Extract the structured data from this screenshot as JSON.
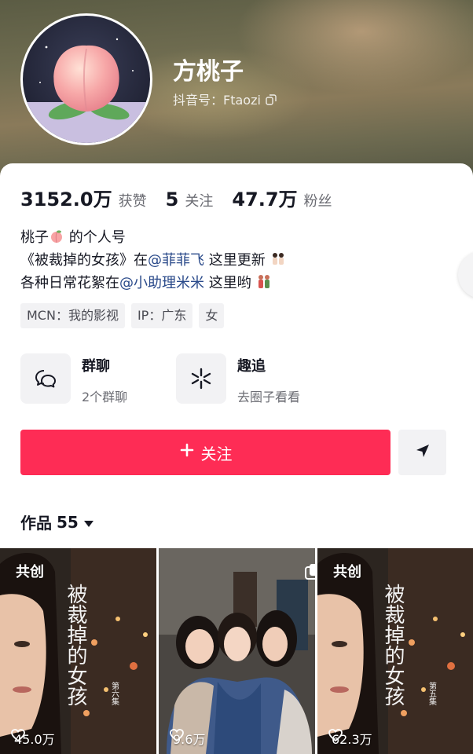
{
  "profile": {
    "name": "方桃子",
    "douyin_id": "抖音号：Ftaozi"
  },
  "stats": [
    {
      "num": "3152.0万",
      "label": "获赞"
    },
    {
      "num": "5",
      "label": "关注"
    },
    {
      "num": "47.7万",
      "label": "粉丝"
    }
  ],
  "bio": {
    "line1_a": "桃子",
    "line1_b": " 的个人号",
    "line2_a": "《被裁掉的女孩》在",
    "line2_mention": "@菲菲飞",
    "line2_b": " 这里更新",
    "line3_a": "各种日常花絮在",
    "line3_mention": "@小助理米米",
    "line3_b": " 这里哟"
  },
  "tags": [
    "MCN：我的影视",
    "IP：广东",
    "女"
  ],
  "features": [
    {
      "title": "群聊",
      "sub": "2个群聊",
      "icon": "group-chat-icon"
    },
    {
      "title": "趣追",
      "sub": "去圈子看看",
      "icon": "sparkle-icon"
    }
  ],
  "actions": {
    "follow_label": "关注",
    "follow_icon": "plus-icon",
    "send_icon": "send-icon"
  },
  "works": {
    "title": "作品",
    "count": "55"
  },
  "videos": [
    {
      "badge": "共创",
      "likes": "45.0万"
    },
    {
      "badge": "",
      "likes": "9.6万"
    },
    {
      "badge": "共创",
      "likes": "62.3万"
    }
  ],
  "colors": {
    "accent": "#fe2c55",
    "mention": "#2a4a8a"
  }
}
